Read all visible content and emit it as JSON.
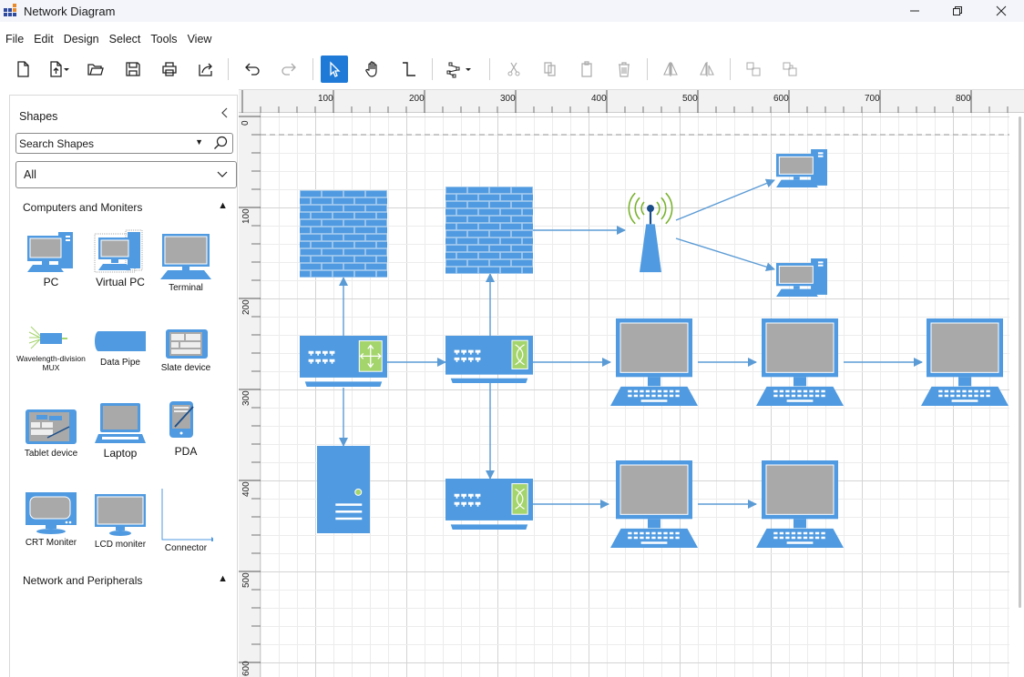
{
  "window": {
    "title": "Network Diagram",
    "controls": [
      "minimize",
      "maximize",
      "close"
    ]
  },
  "menu": [
    "File",
    "Edit",
    "Design",
    "Select",
    "Tools",
    "View"
  ],
  "toolbar": {
    "items": [
      {
        "name": "new-file",
        "icon": "new-document-icon"
      },
      {
        "name": "import",
        "icon": "import-icon"
      },
      {
        "name": "open",
        "icon": "folder-open-icon"
      },
      {
        "name": "save",
        "icon": "save-icon"
      },
      {
        "name": "print",
        "icon": "print-icon"
      },
      {
        "name": "export",
        "icon": "export-icon"
      },
      {
        "name": "undo",
        "icon": "undo-icon"
      },
      {
        "name": "redo",
        "icon": "redo-icon"
      },
      {
        "name": "select-tool",
        "icon": "pointer-icon",
        "active": true
      },
      {
        "name": "pan-tool",
        "icon": "hand-icon"
      },
      {
        "name": "connector-tool",
        "icon": "connector-icon"
      },
      {
        "name": "connector-type",
        "icon": "connector-type-icon"
      },
      {
        "name": "cut",
        "icon": "cut-icon"
      },
      {
        "name": "copy",
        "icon": "copy-icon"
      },
      {
        "name": "paste",
        "icon": "paste-icon"
      },
      {
        "name": "delete",
        "icon": "delete-icon"
      },
      {
        "name": "flip-horizontal",
        "icon": "flip-horizontal-icon"
      },
      {
        "name": "flip-vertical",
        "icon": "flip-vertical-icon"
      },
      {
        "name": "bring-forward",
        "icon": "bring-forward-icon"
      },
      {
        "name": "send-backward",
        "icon": "send-backward-icon"
      }
    ],
    "accent": "#1e7ad6"
  },
  "sidebar": {
    "title": "Shapes",
    "search_placeholder": "Search Shapes",
    "filter_value": "All",
    "categories": [
      {
        "label": "Computers and Moniters",
        "expanded": true,
        "shapes": [
          "PC",
          "Virtual PC",
          "Terminal",
          "Wavelength-division MUX",
          "Data Pipe",
          "Slate device",
          "Tablet device",
          "Laptop",
          "PDA",
          "CRT Moniter",
          "LCD moniter",
          "Connector"
        ]
      },
      {
        "label": "Network and Peripherals",
        "expanded": false,
        "shapes": []
      }
    ]
  },
  "rulers": {
    "horizontal": [
      "100",
      "200",
      "300",
      "400",
      "500",
      "600",
      "700",
      "800"
    ],
    "vertical": [
      "0",
      "100",
      "200",
      "300",
      "400",
      "500",
      "600"
    ]
  },
  "diagram": {
    "colors": {
      "shape": "#4f9ae0",
      "screen": "#a9a9a9",
      "accent_green": "#a4d46c",
      "signal": "#7ab32e",
      "connector": "#5b9bd5"
    },
    "nodes": [
      {
        "id": "firewall-1",
        "type": "firewall"
      },
      {
        "id": "firewall-2",
        "type": "firewall"
      },
      {
        "id": "wireless-tower",
        "type": "wireless-access-point"
      },
      {
        "id": "pc-top",
        "type": "pc"
      },
      {
        "id": "pc-mid",
        "type": "pc"
      },
      {
        "id": "router",
        "type": "router"
      },
      {
        "id": "switch-1",
        "type": "switch"
      },
      {
        "id": "switch-2",
        "type": "switch"
      },
      {
        "id": "terminal-1",
        "type": "terminal"
      },
      {
        "id": "terminal-2",
        "type": "terminal"
      },
      {
        "id": "terminal-3",
        "type": "terminal"
      },
      {
        "id": "terminal-4",
        "type": "terminal"
      },
      {
        "id": "terminal-5",
        "type": "terminal"
      },
      {
        "id": "server",
        "type": "server"
      }
    ],
    "connectors": [
      {
        "from": "router",
        "to": "firewall-1"
      },
      {
        "from": "router",
        "to": "switch-1"
      },
      {
        "from": "router",
        "to": "server"
      },
      {
        "from": "switch-1",
        "to": "firewall-2"
      },
      {
        "from": "switch-1",
        "to": "switch-2"
      },
      {
        "from": "switch-1",
        "to": "terminal-1"
      },
      {
        "from": "firewall-2",
        "to": "wireless-tower"
      },
      {
        "from": "wireless-tower",
        "to": "pc-top"
      },
      {
        "from": "wireless-tower",
        "to": "pc-mid"
      },
      {
        "from": "terminal-1",
        "to": "terminal-2"
      },
      {
        "from": "terminal-2",
        "to": "terminal-3"
      },
      {
        "from": "switch-2",
        "to": "terminal-4"
      },
      {
        "from": "terminal-4",
        "to": "terminal-5"
      }
    ]
  }
}
